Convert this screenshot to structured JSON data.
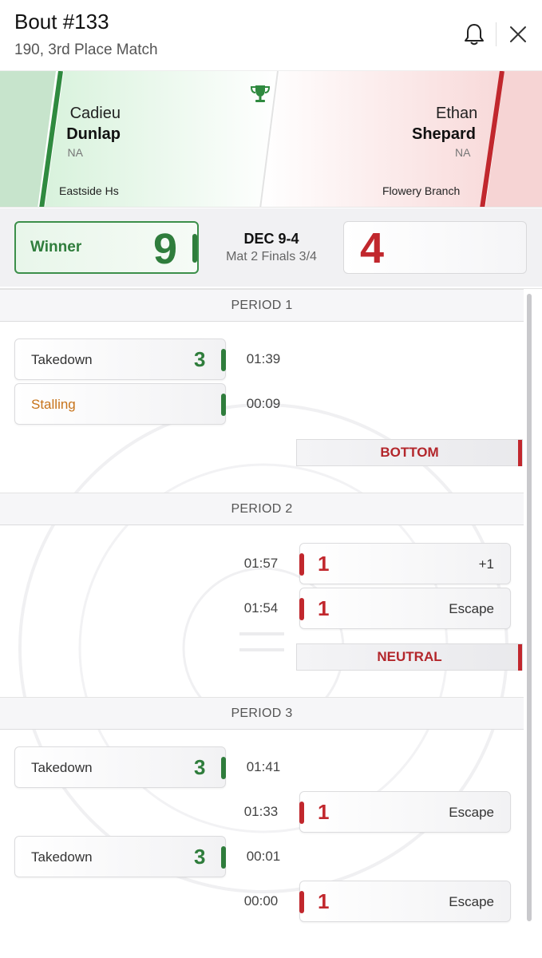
{
  "header": {
    "title": "Bout #133",
    "subtitle": "190, 3rd Place Match",
    "bell_icon": "bell-icon",
    "close_icon": "close-icon"
  },
  "matchup": {
    "winner": {
      "first_name": "Cadieu",
      "last_name": "Dunlap",
      "grade": "NA",
      "team": "Eastside Hs",
      "color": "#2f7d3c"
    },
    "loser": {
      "first_name": "Ethan",
      "last_name": "Shepard",
      "grade": "NA",
      "team": "Flowery Branch",
      "color": "#c1272d"
    },
    "trophy_icon": "trophy-icon"
  },
  "score": {
    "winner_label": "Winner",
    "winner_score": "9",
    "loser_score": "4",
    "result": "DEC 9-4",
    "mat_info": "Mat 2 Finals 3/4"
  },
  "periods": [
    {
      "title": "PERIOD 1",
      "events": [
        {
          "side": "left",
          "label": "Takedown",
          "points": "3",
          "time": "01:39"
        },
        {
          "side": "left",
          "label": "Stalling",
          "points": "",
          "time": "00:09",
          "warning": true
        }
      ],
      "position": "BOTTOM"
    },
    {
      "title": "PERIOD 2",
      "events": [
        {
          "side": "right",
          "label": "+1",
          "points": "1",
          "time": "01:57"
        },
        {
          "side": "right",
          "label": "Escape",
          "points": "1",
          "time": "01:54"
        }
      ],
      "position": "NEUTRAL"
    },
    {
      "title": "PERIOD 3",
      "events": [
        {
          "side": "left",
          "label": "Takedown",
          "points": "3",
          "time": "01:41"
        },
        {
          "side": "right",
          "label": "Escape",
          "points": "1",
          "time": "01:33"
        },
        {
          "side": "left",
          "label": "Takedown",
          "points": "3",
          "time": "00:01"
        },
        {
          "side": "right",
          "label": "Escape",
          "points": "1",
          "time": "00:00"
        }
      ]
    }
  ]
}
